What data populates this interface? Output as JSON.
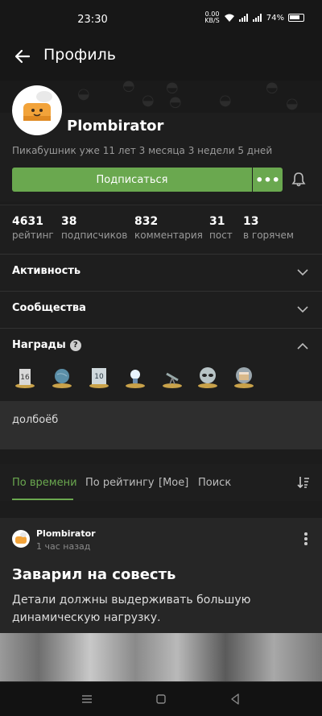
{
  "status_bar": {
    "time": "23:30",
    "net_speed_value": "0.00",
    "net_speed_unit": "KB/S",
    "battery": "74%"
  },
  "header": {
    "title": "Профиль"
  },
  "profile": {
    "username": "Plombirator",
    "since": "Пикабушник уже 11 лет 3 месяца 3 недели 5 дней",
    "subscribe_label": "Подписаться",
    "more_label": "•••"
  },
  "stats": [
    {
      "value": "4631",
      "label": "рейтинг"
    },
    {
      "value": "38",
      "label": "подписчиков"
    },
    {
      "value": "832",
      "label": "комментария"
    },
    {
      "value": "31",
      "label": "пост"
    },
    {
      "value": "13",
      "label": "в горячем"
    }
  ],
  "sections": {
    "activity": "Активность",
    "communities": "Сообщества",
    "awards": "Награды"
  },
  "awards_icons": [
    "award-16-years-icon",
    "award-globe-icon",
    "award-10-years-icon",
    "award-lightbulb-icon",
    "award-telescope-icon",
    "award-alien-icon",
    "award-cake-icon"
  ],
  "note": "долбоёб",
  "tabs": [
    "По времени",
    "По рейтингу",
    "[Мое]",
    "Поиск"
  ],
  "post": {
    "author": "Plombirator",
    "time": "1 час назад",
    "title": "Заварил на совесть",
    "text": "Детали должны выдерживать большую динамическую нагрузку."
  },
  "colors": {
    "accent": "#6aa84f",
    "background": "#1c1c1c"
  }
}
